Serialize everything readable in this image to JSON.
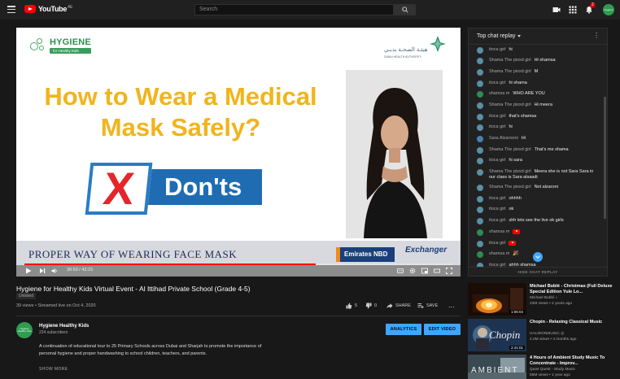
{
  "header": {
    "logo_text": "YouTube",
    "logo_region": "AE",
    "search_placeholder": "Search",
    "notifications_count": "2",
    "avatar_label": "Hygiene"
  },
  "video": {
    "slide_brand": "HYGIENE",
    "slide_brand_sub": "for Healthy Kids",
    "dha_arabic": "هيئـة الصحـة بدبـي",
    "dha_english": "DUBAI HEALTH AUTHORITY",
    "slide_title": "How to Wear a Medical Mask Safely?",
    "donts_x": "X",
    "donts_label": "Don'ts",
    "lower_strip": "PROPER WAY OF WEARING FACE MASK",
    "sponsor1": "Emirates NBD",
    "sponsor2": "Exchanger",
    "timecode": "30:50 / 43:23",
    "progress_fraction": 0.68
  },
  "chat": {
    "header": "Top chat replay",
    "hide_label": "HIDE CHAT REPLAY",
    "messages": [
      {
        "name": "itoca girl",
        "text": "hi",
        "color": "#5a8fa6"
      },
      {
        "name": "Shama The pixxd girl",
        "text": "Hi shamsa",
        "color": "#5a8fa6"
      },
      {
        "name": "Shama The pixxd girl",
        "text": "M",
        "color": "#5a8fa6"
      },
      {
        "name": "itoca girl",
        "text": "hi shama",
        "color": "#5a8fa6"
      },
      {
        "name": "shamsa m",
        "text": "WHO ARE YOU",
        "color": "#2e8b57"
      },
      {
        "name": "Shama The pixxd girl",
        "text": "Hi meera",
        "color": "#5a8fa6"
      },
      {
        "name": "itoca girl",
        "text": "that's shamsa",
        "color": "#5a8fa6"
      },
      {
        "name": "itoca girl",
        "text": "hi",
        "color": "#5a8fa6"
      },
      {
        "name": "Sara Alzarooni",
        "text": "Hi",
        "color": "#4a7fb5"
      },
      {
        "name": "Shama The pixxd girl",
        "text": "That's me shama",
        "color": "#5a8fa6"
      },
      {
        "name": "itoca girl",
        "text": "hi sara",
        "color": "#5a8fa6"
      },
      {
        "name": "Shama The pixxd girl",
        "text": "Meera she is not Sara Sara in our class is Sara alsaadi",
        "color": "#5a8fa6"
      },
      {
        "name": "Shama The pixxd girl",
        "text": "Not alzaroni",
        "color": "#5a8fa6"
      },
      {
        "name": "itoca girl",
        "text": "ohhhh",
        "color": "#5a8fa6"
      },
      {
        "name": "itoca girl",
        "text": "ok",
        "color": "#5a8fa6"
      },
      {
        "name": "itoca girl",
        "text": "shh lets see the live ok girls",
        "color": "#5a8fa6"
      },
      {
        "name": "shamsa m",
        "text": "",
        "emoji": "youtube",
        "color": "#2e8b57"
      },
      {
        "name": "itoca girl",
        "text": "",
        "emoji": "youtube",
        "color": "#5a8fa6"
      },
      {
        "name": "shamsa m",
        "text": "",
        "emoji": "party",
        "color": "#2e8b57"
      },
      {
        "name": "itoca girl",
        "text": "ahhh shamsa",
        "color": "#5a8fa6"
      }
    ]
  },
  "details": {
    "title": "Hygiene for Healthy Kids Virtual Event - Al Ittihad Private School (Grade 4-5)",
    "unlisted": "Unlisted",
    "meta": "39 views • Streamed live on Oct 4, 2020",
    "likes": "5",
    "dislikes": "0",
    "share": "SHARE",
    "save": "SAVE",
    "more": "...",
    "channel_name": "Hygiene Healthy Kids",
    "subscribers": "224 subscribers",
    "analytics_btn": "ANALYTICS",
    "edit_btn": "EDIT VIDEO",
    "description": "A continuation of educational tour to 25 Primary Schools across Dubai and Sharjah to promote the importance of personal hygiene and proper handwashing to school children, teachers, and parents.",
    "show_more": "SHOW MORE"
  },
  "recommendations": [
    {
      "title": "Michael Bublé - Christmas (Full Deluxe Special Edition Yule Lo...",
      "channel": "Michael Bublé ♪",
      "meta": "23M views • 2 years ago",
      "duration": "1:05:04"
    },
    {
      "title": "Chopin - Relaxing Classical Music",
      "channel": "HALIDONMUSIC ◎",
      "meta": "2.2M views • 4 months ago",
      "duration": "2:41:01",
      "thumb_text": "Chopin"
    },
    {
      "title": "4 Hours of Ambient Study Music To Concentrate - Improv...",
      "channel": "Quiet Quest - Study Music",
      "meta": "56M views • 1 year ago",
      "duration": "",
      "thumb_text": "AMBIENT"
    }
  ]
}
